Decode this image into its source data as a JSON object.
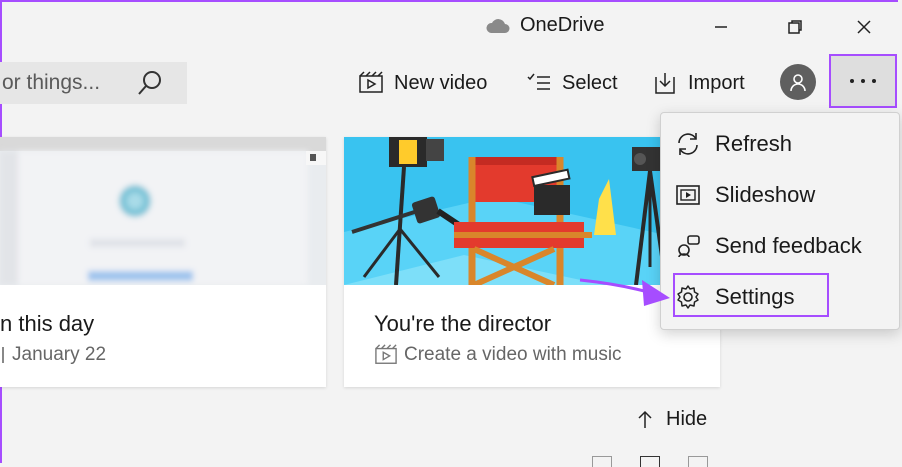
{
  "window": {
    "title": "OneDrive"
  },
  "search": {
    "placeholder": "or things..."
  },
  "toolbar": {
    "new_video": "New video",
    "select": "Select",
    "import": "Import"
  },
  "cards": [
    {
      "title": "n this day",
      "subtitle": "January 22"
    },
    {
      "title": "You're the director",
      "subtitle": "Create a video with music"
    }
  ],
  "menu": {
    "items": [
      "Refresh",
      "Slideshow",
      "Send feedback",
      "Settings"
    ]
  },
  "hide_label": "Hide",
  "colors": {
    "highlight": "#a64dff",
    "accent_red": "#d62b2b",
    "scene_blue": "#39c3f0"
  }
}
